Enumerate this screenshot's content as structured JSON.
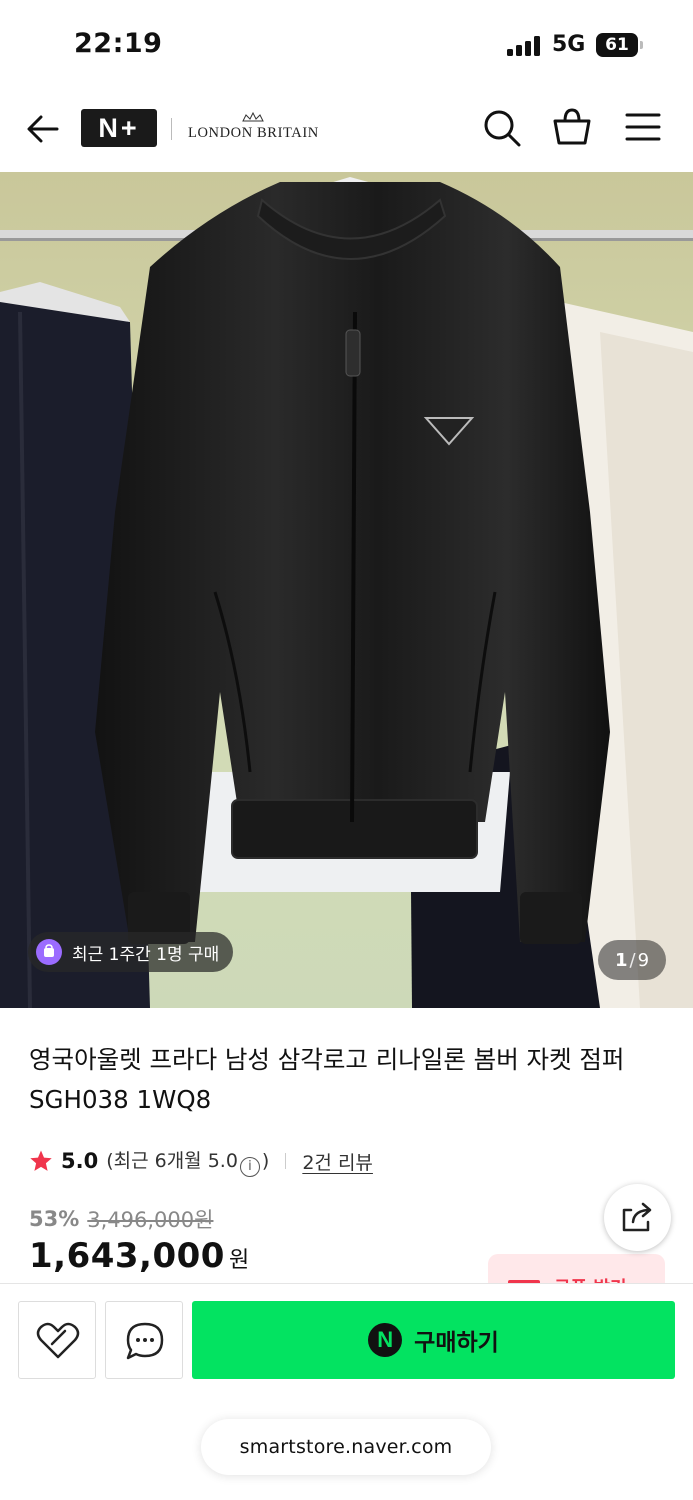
{
  "status_bar": {
    "time": "22:19",
    "network": "5G",
    "battery": "61"
  },
  "header": {
    "store_logo": "N+",
    "brand": "LONDON BRITAIN",
    "icons": [
      "back-arrow-icon",
      "search-icon",
      "cart-icon",
      "menu-icon"
    ]
  },
  "gallery": {
    "purchase_badge": "최근 1주간 1명 구매",
    "current_index": "1",
    "separator": "/",
    "total": "9"
  },
  "product": {
    "title": "영국아울렛 프라다 남성 삼각로고 리나일론 봄버 자켓 점퍼 SGH038 1WQ8",
    "rating": {
      "score": "5.0",
      "recent_prefix": "(최근 6개월 5.0",
      "recent_suffix": ")",
      "info_glyph": "i",
      "review_link": "2건 리뷰"
    },
    "price": {
      "discount_rate": "53%",
      "original": "3,496,000원",
      "sale": "1,643,000",
      "unit": "원"
    },
    "coupon_label": "쿠폰 받기"
  },
  "actions": {
    "buy_label": "구매하기",
    "npay_glyph": "N"
  },
  "footer": {
    "url": "smartstore.naver.com"
  },
  "colors": {
    "buy_green": "#03e361",
    "star_red": "#f0354c",
    "badge_purple": "#9b6cff"
  }
}
